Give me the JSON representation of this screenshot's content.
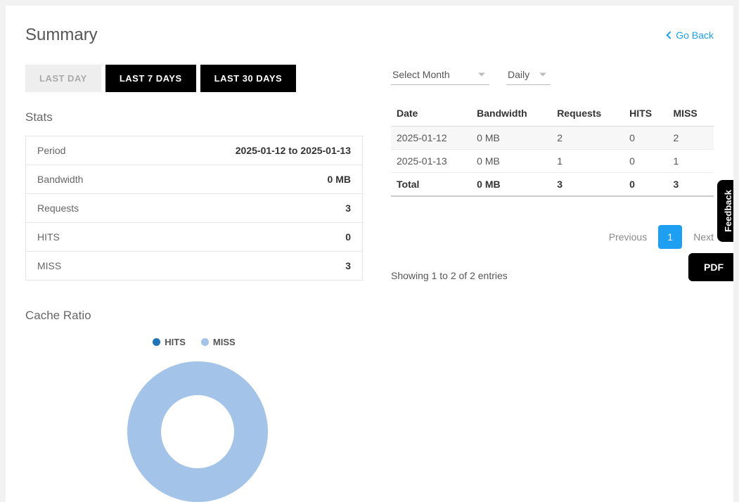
{
  "header": {
    "title": "Summary",
    "goBack": "Go Back"
  },
  "tabs": {
    "lastDay": "LAST DAY",
    "last7": "LAST 7 DAYS",
    "last30": "LAST 30 DAYS"
  },
  "sections": {
    "stats": "Stats",
    "cacheRatio": "Cache Ratio"
  },
  "stats": {
    "rows": [
      {
        "label": "Period",
        "value": "2025-01-12 to 2025-01-13"
      },
      {
        "label": "Bandwidth",
        "value": "0 MB"
      },
      {
        "label": "Requests",
        "value": "3"
      },
      {
        "label": "HITS",
        "value": "0"
      },
      {
        "label": "MISS",
        "value": "3"
      }
    ]
  },
  "selects": {
    "month": "Select Month",
    "granularity": "Daily"
  },
  "dataTable": {
    "headers": {
      "date": "Date",
      "bandwidth": "Bandwidth",
      "requests": "Requests",
      "hits": "HITS",
      "miss": "MISS"
    },
    "rows": [
      {
        "date": "2025-01-12",
        "bandwidth": "0 MB",
        "requests": "2",
        "hits": "0",
        "miss": "2"
      },
      {
        "date": "2025-01-13",
        "bandwidth": "0 MB",
        "requests": "1",
        "hits": "0",
        "miss": "1"
      }
    ],
    "total": {
      "label": "Total",
      "bandwidth": "0 MB",
      "requests": "3",
      "hits": "0",
      "miss": "3"
    }
  },
  "pagination": {
    "previous": "Previous",
    "current": "1",
    "next": "Next",
    "info": "Showing 1 to 2 of 2 entries"
  },
  "legend": {
    "hits": "HITS",
    "miss": "MISS"
  },
  "colors": {
    "hits": "#1e75bb",
    "miss": "#a4c3e8",
    "accent": "#1e9ff2"
  },
  "buttons": {
    "pdf": "PDF",
    "feedback": "Feedback"
  },
  "chart_data": {
    "type": "pie",
    "title": "Cache Ratio",
    "series": [
      {
        "name": "HITS",
        "value": 0,
        "color": "#1e75bb"
      },
      {
        "name": "MISS",
        "value": 3,
        "color": "#a4c3e8"
      }
    ]
  }
}
